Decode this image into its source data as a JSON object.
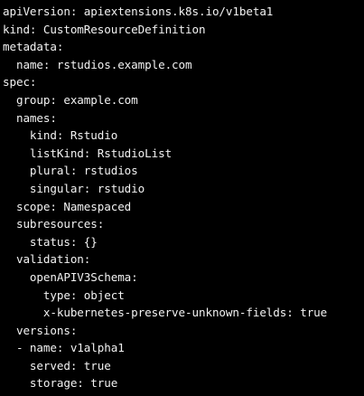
{
  "terminal": {
    "background": "#000000",
    "foreground": "#f2f2f2",
    "lines": [
      "apiVersion: apiextensions.k8s.io/v1beta1",
      "kind: CustomResourceDefinition",
      "metadata:",
      "  name: rstudios.example.com",
      "spec:",
      "  group: example.com",
      "  names:",
      "    kind: Rstudio",
      "    listKind: RstudioList",
      "    plural: rstudios",
      "    singular: rstudio",
      "  scope: Namespaced",
      "  subresources:",
      "    status: {}",
      "  validation:",
      "    openAPIV3Schema:",
      "      type: object",
      "      x-kubernetes-preserve-unknown-fields: true",
      "  versions:",
      "  - name: v1alpha1",
      "    served: true",
      "    storage: true"
    ]
  }
}
